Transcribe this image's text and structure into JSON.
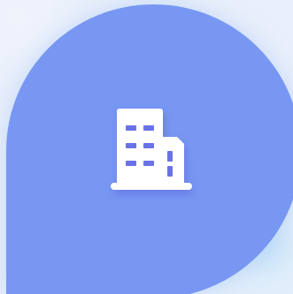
{
  "icon": {
    "name": "office-building-icon",
    "tile_color": "#7897f2",
    "glyph_color": "#ffffff",
    "window_color": "#6a72e6",
    "shadow_color": "#5b5fe0"
  }
}
